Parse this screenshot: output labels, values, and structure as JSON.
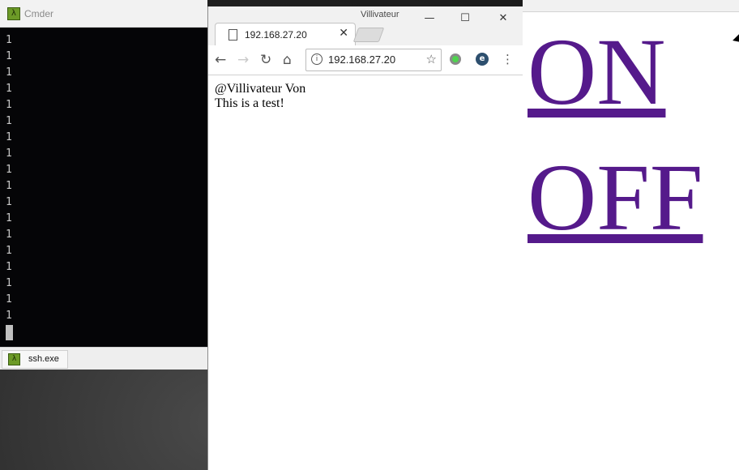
{
  "cmder": {
    "title": "Cmder",
    "app_icon": "λ",
    "output_lines": [
      "1",
      "1",
      "1",
      "1",
      "1",
      "1",
      "1",
      "1",
      "1",
      "1",
      "1",
      "1",
      "1",
      "1",
      "1",
      "1",
      "1",
      "1"
    ],
    "tab_label": "ssh.exe",
    "tab_icon": "λ"
  },
  "chrome": {
    "window_title": "Villivateur",
    "tab_title": "192.168.27.20",
    "address": "192.168.27.20",
    "page_lines": [
      "@Villivateur Von",
      "This is a test!"
    ],
    "icons": {
      "back": "←",
      "forward": "→",
      "reload": "↻",
      "home": "⌂",
      "info": "i",
      "star": "☆",
      "extension_ghostery": "e",
      "menu": "⋮",
      "minimize": "—",
      "maximize": "☐",
      "close": "✕",
      "tab_close": "✕"
    }
  },
  "right_window": {
    "url_fragment": "",
    "links": [
      "ON",
      "OFF"
    ],
    "link_color": "#551a8b"
  },
  "colors": {
    "accent_link": "#551a8b",
    "cmder_icon": "#6c9a27",
    "terminal_bg": "#050507"
  }
}
